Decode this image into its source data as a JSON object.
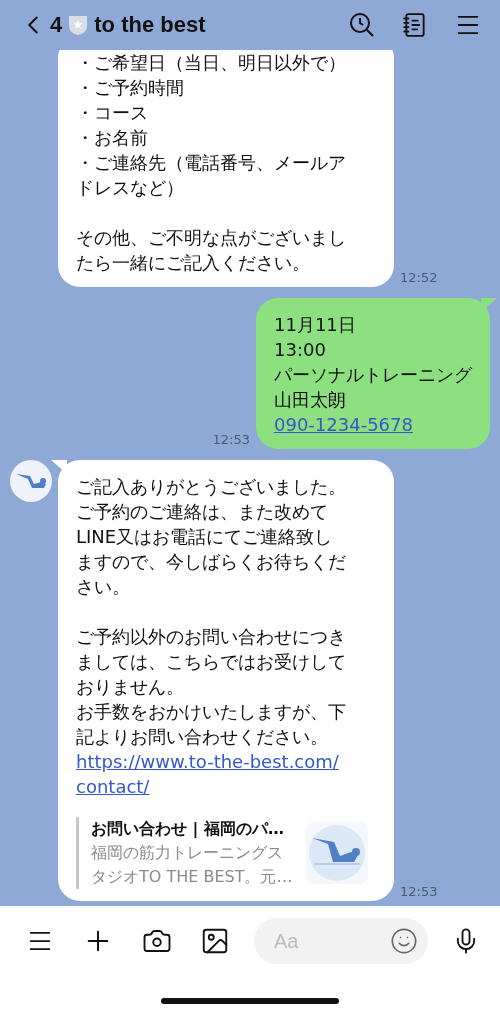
{
  "header": {
    "back_count": "4",
    "title": "to the best"
  },
  "messages": [
    {
      "kind": "received",
      "avatar": false,
      "paragraphs": [
        [
          "・ご希望日（当日、明日以外で）",
          "・ご予約時間",
          "・コース",
          "・お名前",
          "・ご連絡先（電話番号、メールア",
          "ドレスなど）"
        ],
        [
          "その他、ご不明な点がございまし",
          "たら一緒にご記入ください。"
        ]
      ],
      "time": "12:52"
    },
    {
      "kind": "sent",
      "paragraphs": [
        [
          "11月11日",
          "13:00",
          "パーソナルトレーニング",
          "山田太朗"
        ]
      ],
      "link": [
        "090-1234-5678"
      ],
      "time": "12:53"
    },
    {
      "kind": "received",
      "avatar": true,
      "paragraphs": [
        [
          "ご記入ありがとうございました。",
          "ご予約のご連絡は、また改めて",
          "LINE又はお電話にてご連絡致し",
          "ますので、今しばらくお待ちくだ",
          "さい。"
        ],
        [
          "ご予約以外のお問い合わせにつき",
          "ましては、こちらではお受けして",
          "おりません。",
          "お手数をおかけいたしますが、下",
          "記よりお問い合わせください。"
        ]
      ],
      "link": [
        "https://www.to-the-best.com/",
        "contact/"
      ],
      "preview": {
        "title": "お問い合わせ | 福岡のパ…",
        "description": [
          "福岡の筋力トレーニングス",
          "タジオTO THE BEST。元…"
        ]
      },
      "time": "12:53"
    }
  ],
  "composer": {
    "placeholder": "Aa"
  }
}
